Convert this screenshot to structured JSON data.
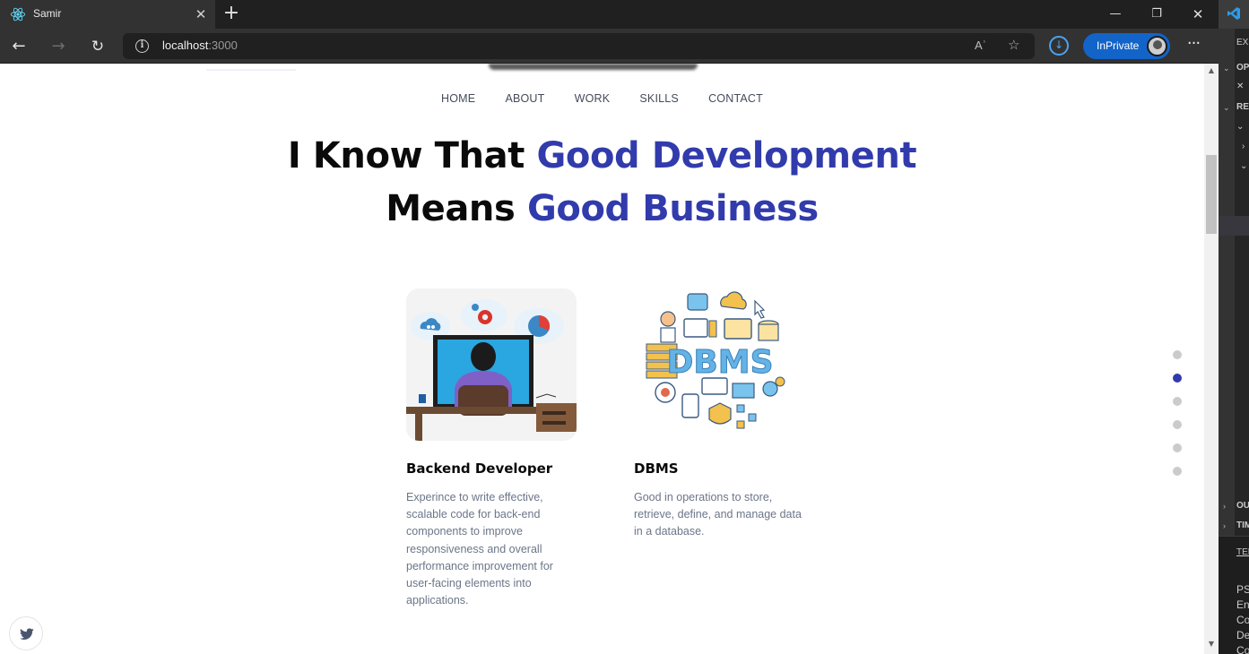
{
  "browser": {
    "tab_title": "Samir",
    "url_host": "localhost",
    "url_port": ":3000",
    "read_aloud": "Aʾ",
    "inprivate_label": "InPrivate"
  },
  "vscode": {
    "items": [
      "EXPLORER",
      "OPEN EDITORS",
      "REACT",
      "OUTLINE",
      "TIMELINE",
      "TERMINAL",
      "PS",
      "En",
      "Co",
      "De",
      "Co"
    ]
  },
  "nav": {
    "items": [
      "HOME",
      "ABOUT",
      "WORK",
      "SKILLS",
      "CONTACT"
    ]
  },
  "headline": {
    "part1": "I Know That ",
    "part1_hl": "Good Development",
    "part2": "Means ",
    "part2_hl": "Good Business"
  },
  "cards": [
    {
      "title": "Backend Developer",
      "description": "Experince to write effective, scalable code for back-end components to improve responsiveness and overall performance improvement for user-facing elements into applications.",
      "image_label": "backend-developer-illustration"
    },
    {
      "title": "DBMS",
      "description": "Good in operations to store, retrieve, define, and manage data in a database.",
      "image_text": "DBMS"
    }
  ],
  "page_dots": {
    "count": 6,
    "active_index": 1
  },
  "colors": {
    "accent": "#313bac",
    "nav_text": "#444b5a",
    "body_text": "#6b7688",
    "browser_bg": "#323232",
    "inprivate_bg": "#1264c8"
  }
}
